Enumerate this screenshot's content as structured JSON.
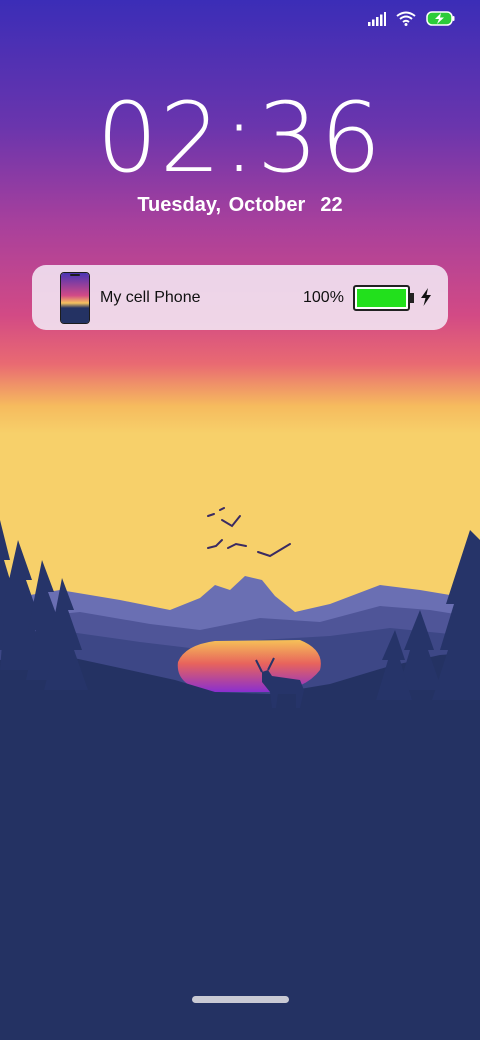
{
  "status_bar": {
    "icons": [
      "signal-icon",
      "wifi-icon",
      "battery-charging-icon"
    ]
  },
  "lock_screen": {
    "time": "02:36",
    "date": "Tuesday, October  22"
  },
  "device_card": {
    "name": "My cell Phone",
    "battery_percent_text": "100%",
    "battery_level": 1.0,
    "battery_color": "#22e01c",
    "charging_icon": "charging-bolt-icon"
  },
  "colors": {
    "sky_top": "#3a2fb8",
    "sky_mid": "#d44b86",
    "horizon": "#f6c95a",
    "ground": "#243263"
  }
}
